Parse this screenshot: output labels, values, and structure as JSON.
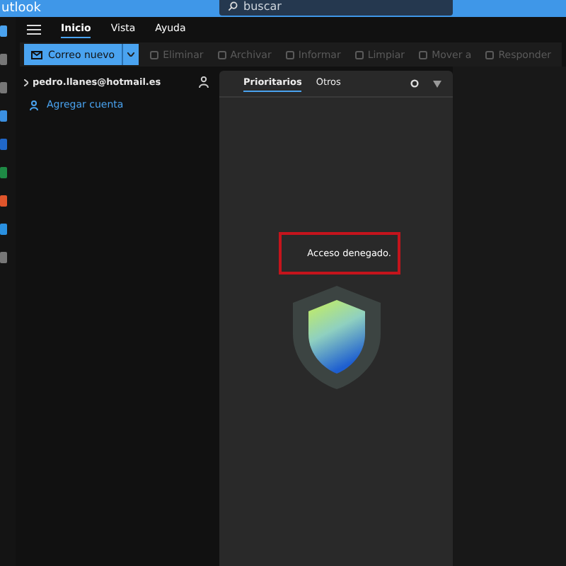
{
  "title_bar": {
    "app_name": "utlook",
    "search": {
      "placeholder": "buscar"
    }
  },
  "menu_tabs": [
    {
      "label": "Inicio",
      "selected": true
    },
    {
      "label": "Vista",
      "selected": false
    },
    {
      "label": "Ayuda",
      "selected": false
    }
  ],
  "toolbar": {
    "new_mail": "Correo nuevo",
    "actions": [
      {
        "label": "Eliminar",
        "disabled": true
      },
      {
        "label": "Archivar",
        "disabled": true
      },
      {
        "label": "Informar",
        "disabled": true
      },
      {
        "label": "Limpiar",
        "disabled": true
      },
      {
        "label": "Mover a",
        "disabled": true
      },
      {
        "label": "Responder",
        "disabled": true
      }
    ]
  },
  "folder_pane": {
    "account": "pedro.llanes@hotmail.es",
    "add_account": "Agregar cuenta"
  },
  "message_list": {
    "tabs": [
      {
        "label": "Prioritarios",
        "selected": true
      },
      {
        "label": "Otros",
        "selected": false
      }
    ],
    "message": "Acceso denegado."
  }
}
